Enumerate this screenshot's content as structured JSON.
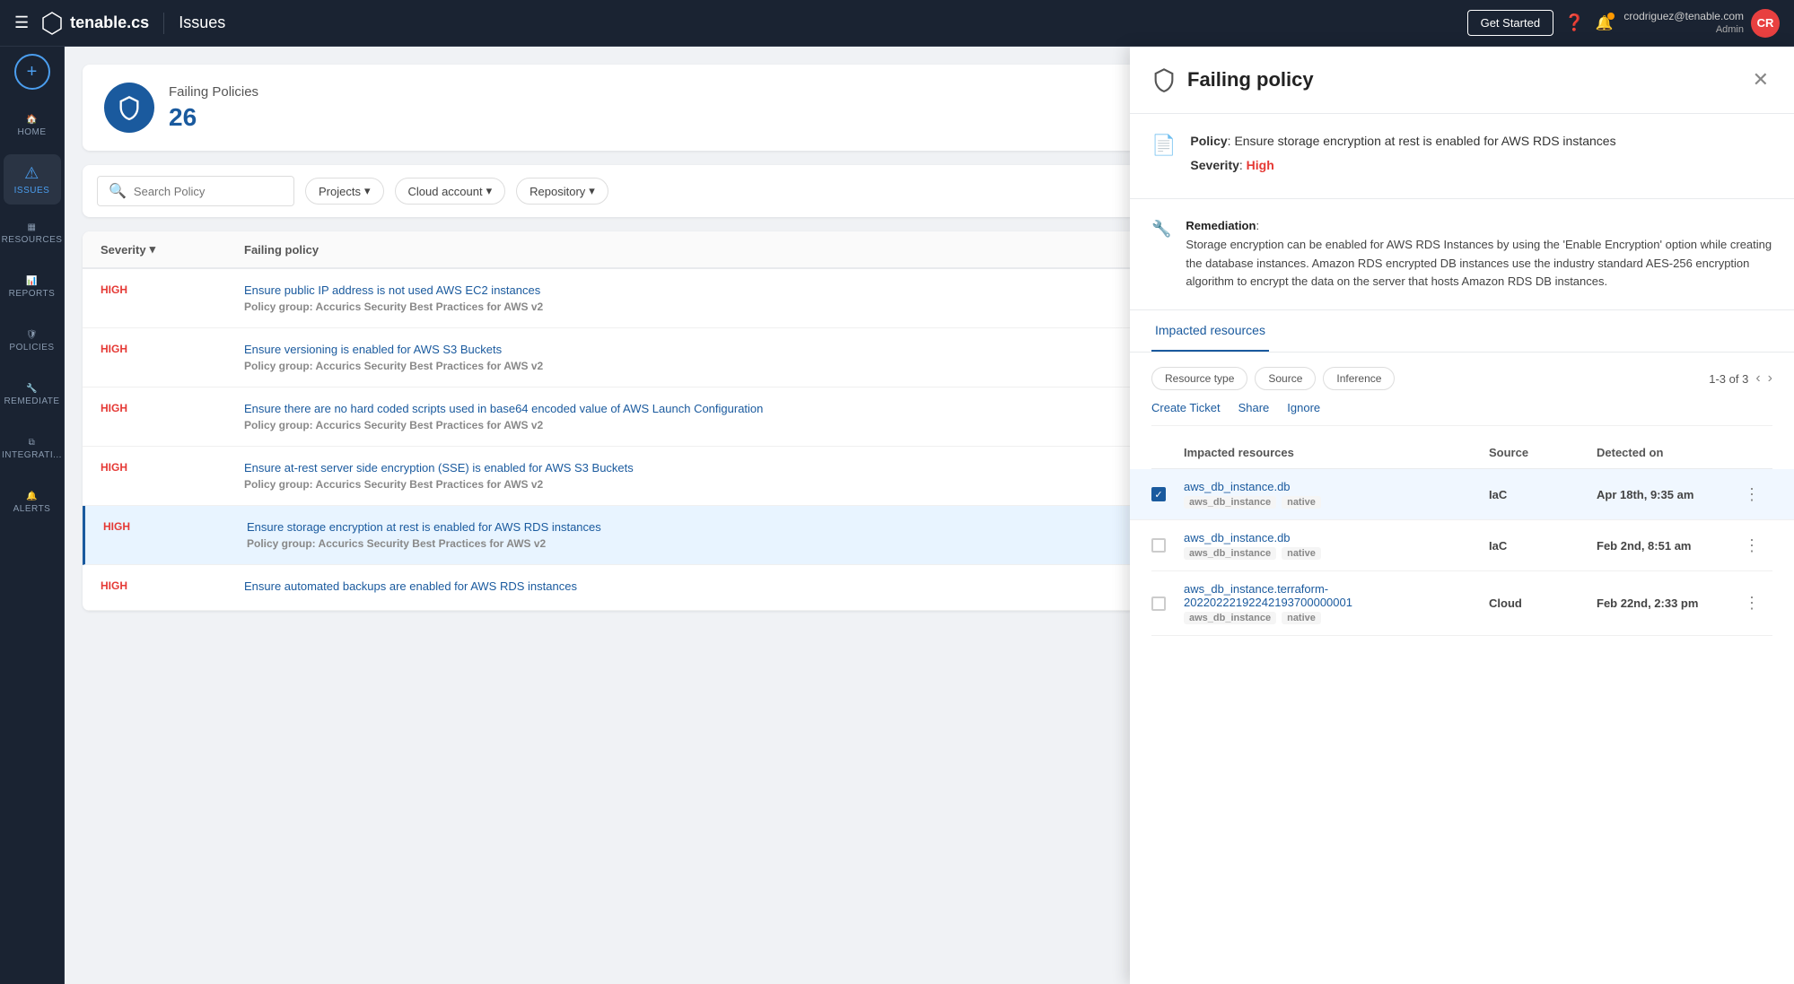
{
  "navbar": {
    "menu_label": "☰",
    "logo_text": "tenable.cs",
    "separator": "|",
    "page_title": "Issues",
    "get_started_label": "Get Started",
    "help_icon": "?",
    "user_email": "crodriguez@tenable.com",
    "user_role": "Admin",
    "user_initials": "CR"
  },
  "sidebar": {
    "add_icon": "+",
    "items": [
      {
        "id": "home",
        "label": "HOME",
        "icon": "⌂"
      },
      {
        "id": "issues",
        "label": "ISSUES",
        "icon": "!",
        "active": true
      },
      {
        "id": "resources",
        "label": "RESOURCES",
        "icon": "▦"
      },
      {
        "id": "reports",
        "label": "REPORTS",
        "icon": "⊞"
      },
      {
        "id": "policies",
        "label": "POLICIES",
        "icon": "⊙"
      },
      {
        "id": "remediate",
        "label": "REMEDIATE",
        "icon": "🔧"
      },
      {
        "id": "integrations",
        "label": "INTEGRATI...",
        "icon": "⧉"
      },
      {
        "id": "alerts",
        "label": "ALERTS",
        "icon": "🔔"
      }
    ]
  },
  "main": {
    "header": {
      "title": "Failing Policies",
      "count": "26"
    },
    "search_placeholder": "Search Policy",
    "filters": [
      "Projects",
      "Cloud account",
      "Repository"
    ],
    "table": {
      "col_severity": "Severity",
      "col_policy": "Failing policy",
      "rows": [
        {
          "severity": "HIGH",
          "policy_name": "Ensure public IP address is not used AWS EC2 instances",
          "policy_group": "Policy group: Accurics Security Best Practices for AWS v2"
        },
        {
          "severity": "HIGH",
          "policy_name": "Ensure versioning is enabled for AWS S3 Buckets",
          "policy_group": "Policy group: Accurics Security Best Practices for AWS v2"
        },
        {
          "severity": "HIGH",
          "policy_name": "Ensure there are no hard coded scripts used in base64 encoded value of AWS Launch Configuration",
          "policy_group": "Policy group: Accurics Security Best Practices for AWS v2"
        },
        {
          "severity": "HIGH",
          "policy_name": "Ensure at-rest server side encryption (SSE) is enabled for AWS S3 Buckets",
          "policy_group": "Policy group: Accurics Security Best Practices for AWS v2"
        },
        {
          "severity": "HIGH",
          "policy_name": "Ensure storage encryption at rest is enabled for AWS RDS instances",
          "policy_group": "Policy group: Accurics Security Best Practices for AWS v2",
          "selected": true
        },
        {
          "severity": "HIGH",
          "policy_name": "Ensure automated backups are enabled for AWS RDS instances",
          "policy_group": ""
        }
      ]
    }
  },
  "panel": {
    "title": "Failing policy",
    "close_label": "✕",
    "policy": {
      "label": "Policy",
      "name": "Ensure storage encryption at rest is enabled for AWS RDS instances",
      "severity_label": "Severity",
      "severity_value": "High"
    },
    "remediation": {
      "label": "Remediation",
      "text": "Storage encryption can be enabled for AWS RDS Instances by using the 'Enable Encryption' option while creating the database instances. Amazon RDS encrypted DB instances use the industry standard AES-256 encryption algorithm to encrypt the data on the server that hosts Amazon RDS DB instances."
    },
    "tabs": [
      "Impacted resources"
    ],
    "impacted": {
      "filter_chips": [
        "Resource type",
        "Source",
        "Inference"
      ],
      "pagination": "1-3 of 3",
      "action_links": [
        "Create Ticket",
        "Share",
        "Ignore"
      ],
      "table": {
        "col_resource": "Impacted resources",
        "col_source": "Source",
        "col_detected": "Detected on",
        "rows": [
          {
            "name": "aws_db_instance.db",
            "tags": [
              "aws_db_instance",
              "native"
            ],
            "source": "IaC",
            "detected": "Apr 18th, 9:35 am",
            "checked": true
          },
          {
            "name": "aws_db_instance.db",
            "tags": [
              "aws_db_instance",
              "native"
            ],
            "source": "IaC",
            "detected": "Feb 2nd, 8:51 am",
            "checked": false
          },
          {
            "name": "aws_db_instance.terraform-20220222192242193700000001",
            "tags": [
              "aws_db_instance",
              "native"
            ],
            "source": "Cloud",
            "detected": "Feb 22nd, 2:33 pm",
            "checked": false
          }
        ]
      }
    }
  }
}
